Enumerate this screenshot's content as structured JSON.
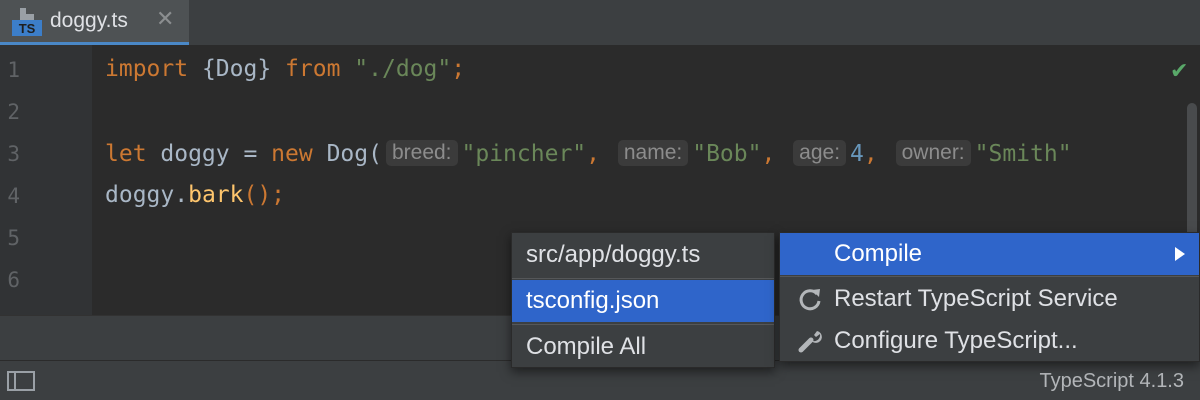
{
  "tab": {
    "label": "doggy.ts",
    "icon_text": "TS",
    "icon": "typescript-file-icon"
  },
  "gutter": {
    "lines": [
      "1",
      "2",
      "3",
      "4",
      "5",
      "6"
    ]
  },
  "code": {
    "line1": {
      "kw_import": "import",
      "braces": " {Dog} ",
      "kw_from": "from",
      "space": " ",
      "path": "\"./dog\"",
      "end": ";"
    },
    "line3": {
      "kw_let": "let",
      "mid": " doggy = ",
      "kw_new": "new",
      "ctor": " Dog(",
      "hint_breed": "breed:",
      "val_breed": "\"pincher\"",
      "comma1": ", ",
      "hint_name": "name:",
      "val_name": "\"Bob\"",
      "comma2": ", ",
      "hint_age": "age:",
      "val_age": "4",
      "comma3": ", ",
      "hint_owner": "owner:",
      "val_owner": "\"Smith\""
    },
    "line4": {
      "obj": "doggy.",
      "method": "bark",
      "end": "();"
    }
  },
  "menu_left": {
    "items": [
      "src/app/doggy.ts",
      "tsconfig.json",
      "Compile All"
    ]
  },
  "menu_right": {
    "items": [
      "Compile",
      "Restart TypeScript Service",
      "Configure TypeScript..."
    ]
  },
  "status": {
    "version": "TypeScript 4.1.3"
  },
  "colors": {
    "selection": "#2f65ca",
    "check": "#59a869",
    "keyword": "#cc7832",
    "string": "#6a8759",
    "number": "#6897bb"
  }
}
